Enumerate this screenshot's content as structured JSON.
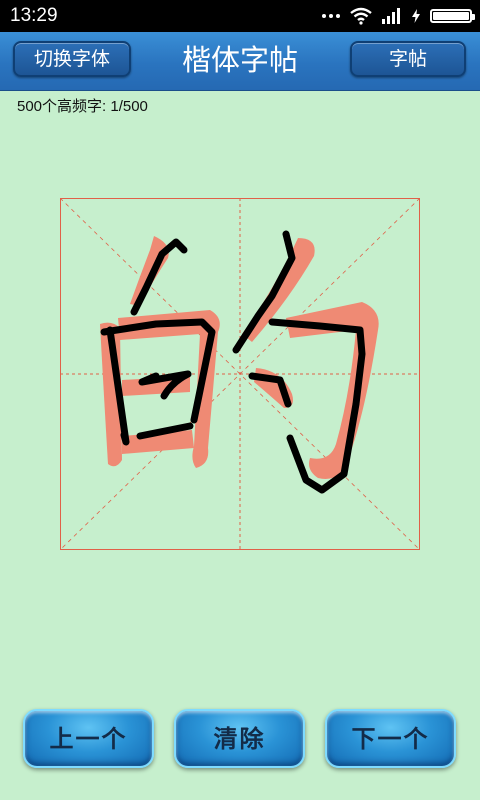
{
  "status_bar": {
    "time": "13:29",
    "icons": [
      "dots-icon",
      "wifi-icon",
      "signal-icon",
      "charging-icon",
      "battery-icon"
    ]
  },
  "header": {
    "switch_font_label": "切换字体",
    "title": "楷体字帖",
    "copybook_label": "字帖"
  },
  "progress": {
    "label": "500个高频字: 1/500",
    "current": 1,
    "total": 500
  },
  "practice": {
    "character": "的"
  },
  "colors": {
    "background": "#c6efcd",
    "guide_lines": "#e06048",
    "template_stroke": "#ef8a74",
    "ink": "#000000",
    "header": "#2a74bf"
  },
  "buttons": {
    "prev_label": "上一个",
    "clear_label": "清除",
    "next_label": "下一个"
  }
}
